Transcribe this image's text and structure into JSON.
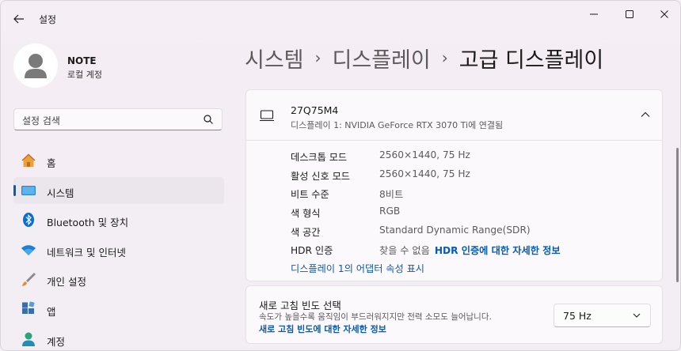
{
  "window": {
    "title": "설정"
  },
  "profile": {
    "name": "NOTE",
    "account_type": "로컬 계정"
  },
  "search": {
    "placeholder": "설정 검색"
  },
  "sidebar": {
    "items": [
      {
        "label": "홈",
        "icon": "home-icon"
      },
      {
        "label": "시스템",
        "icon": "system-icon",
        "active": true
      },
      {
        "label": "Bluetooth 및 장치",
        "icon": "bluetooth-icon"
      },
      {
        "label": "네트워크 및 인터넷",
        "icon": "wifi-icon"
      },
      {
        "label": "개인 설정",
        "icon": "brush-icon"
      },
      {
        "label": "앱",
        "icon": "apps-icon"
      },
      {
        "label": "계정",
        "icon": "account-icon"
      }
    ]
  },
  "breadcrumb": {
    "items": [
      "시스템",
      "디스플레이",
      "고급 디스플레이"
    ]
  },
  "monitor": {
    "name": "27Q75M4",
    "description": "디스플레이 1: NVIDIA GeForce RTX 3070 Ti에 연결됨",
    "specs": [
      {
        "label": "데스크톱 모드",
        "value": "2560×1440, 75 Hz"
      },
      {
        "label": "활성 신호 모드",
        "value": "2560×1440, 75 Hz"
      },
      {
        "label": "비트 수준",
        "value": "8비트"
      },
      {
        "label": "색 형식",
        "value": "RGB"
      },
      {
        "label": "색 공간",
        "value": "Standard Dynamic Range(SDR)"
      },
      {
        "label": "HDR 인증",
        "value": "찾을 수 없음",
        "link": "HDR 인증에 대한 자세한 정보"
      }
    ],
    "adapter_link": "디스플레이 1의 어댑터 속성 표시"
  },
  "refresh": {
    "title": "새로 고침 빈도 선택",
    "description": "속도가 높을수록 움직임이 부드러워지지만 전력 소모도 늘어납니다.",
    "link": "새로 고침 빈도에 대한 자세한 정보",
    "selected": "75 Hz"
  },
  "colors": {
    "accent": "#005fb8",
    "link": "#0a5ab5",
    "background": "#f3eff4",
    "card": "#fbf9fb"
  }
}
